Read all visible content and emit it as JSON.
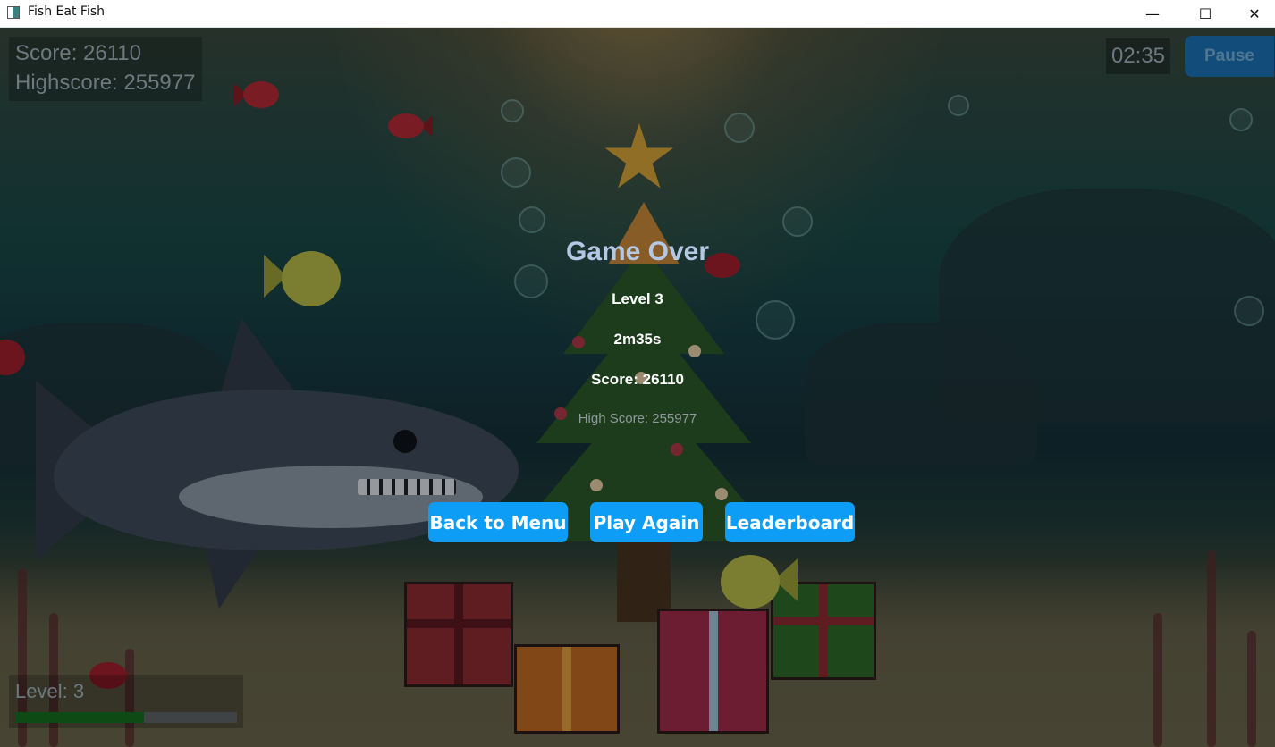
{
  "window": {
    "title": "Fish Eat Fish",
    "minimize_glyph": "—",
    "maximize_glyph": "☐",
    "close_glyph": "✕"
  },
  "hud": {
    "score_label": "Score: 26110",
    "highscore_label": "Highscore: 255977",
    "timer": "02:35",
    "pause_label": "Pause",
    "level_label": "Level: 3",
    "level_progress": 0.58
  },
  "game_over": {
    "title": "Game Over",
    "level": "Level 3",
    "time": "2m35s",
    "score": "Score: 26110",
    "high_score": "High Score: 255977"
  },
  "buttons": {
    "back_to_menu": "Back to Menu",
    "play_again": "Play Again",
    "leaderboard": "Leaderboard"
  },
  "colors": {
    "button_blue": "#0d9cf6",
    "pause_blue": "#124c7a",
    "title_color": "#b4c8e4",
    "progress_green": "#0e4a14"
  }
}
